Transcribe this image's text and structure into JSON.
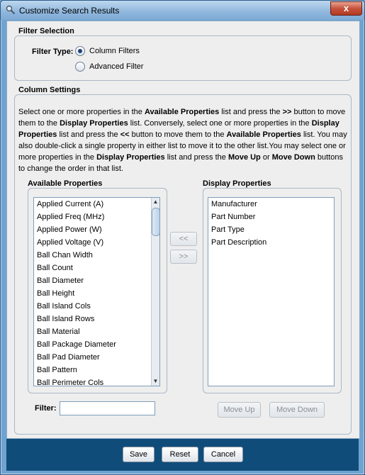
{
  "window": {
    "title": "Customize Search Results",
    "close_label": "x"
  },
  "filter_selection": {
    "title": "Filter Selection",
    "label": "Filter Type:",
    "options": [
      {
        "label": "Column Filters",
        "selected": true
      },
      {
        "label": "Advanced Filter",
        "selected": false
      }
    ]
  },
  "column_settings": {
    "title": "Column Settings",
    "description": [
      {
        "text": "Select one or more properties in the ",
        "bold": false
      },
      {
        "text": "Available Properties",
        "bold": true
      },
      {
        "text": " list and press the ",
        "bold": false
      },
      {
        "text": ">>",
        "bold": true
      },
      {
        "text": " button to move them to the ",
        "bold": false
      },
      {
        "text": "Display Properties",
        "bold": true
      },
      {
        "text": " list. Conversely, select one or more properties in the ",
        "bold": false
      },
      {
        "text": "Display Properties",
        "bold": true
      },
      {
        "text": " list and press the ",
        "bold": false
      },
      {
        "text": "<<",
        "bold": true
      },
      {
        "text": " button to move them to the ",
        "bold": false
      },
      {
        "text": "Available Properties",
        "bold": true
      },
      {
        "text": " list. You may also double-click a single property in either list to move it to the other list.You may select one or more properties in the ",
        "bold": false
      },
      {
        "text": "Display Properties",
        "bold": true
      },
      {
        "text": " list and press the ",
        "bold": false
      },
      {
        "text": "Move Up",
        "bold": true
      },
      {
        "text": " or ",
        "bold": false
      },
      {
        "text": "Move Down",
        "bold": true
      },
      {
        "text": " buttons to change the order in that list.",
        "bold": false
      }
    ],
    "available_title": "Available Properties",
    "available_items": [
      "Applied Current (A)",
      "Applied Freq (MHz)",
      "Applied Power (W)",
      "Applied Voltage (V)",
      "Ball Chan Width",
      "Ball Count",
      "Ball Diameter",
      "Ball Height",
      "Ball Island Cols",
      "Ball Island Rows",
      "Ball Material",
      "Ball Package Diameter",
      "Ball Pad Diameter",
      "Ball Pattern",
      "Ball Perimeter Cols"
    ],
    "display_title": "Display Properties",
    "display_items": [
      "Manufacturer",
      "Part Number",
      "Part Type",
      "Part Description"
    ],
    "move_left_label": "<<",
    "move_right_label": ">>",
    "filter_label": "Filter:",
    "filter_value": "",
    "move_up_label": "Move Up",
    "move_down_label": "Move Down"
  },
  "footer": {
    "save_label": "Save",
    "reset_label": "Reset",
    "cancel_label": "Cancel"
  }
}
